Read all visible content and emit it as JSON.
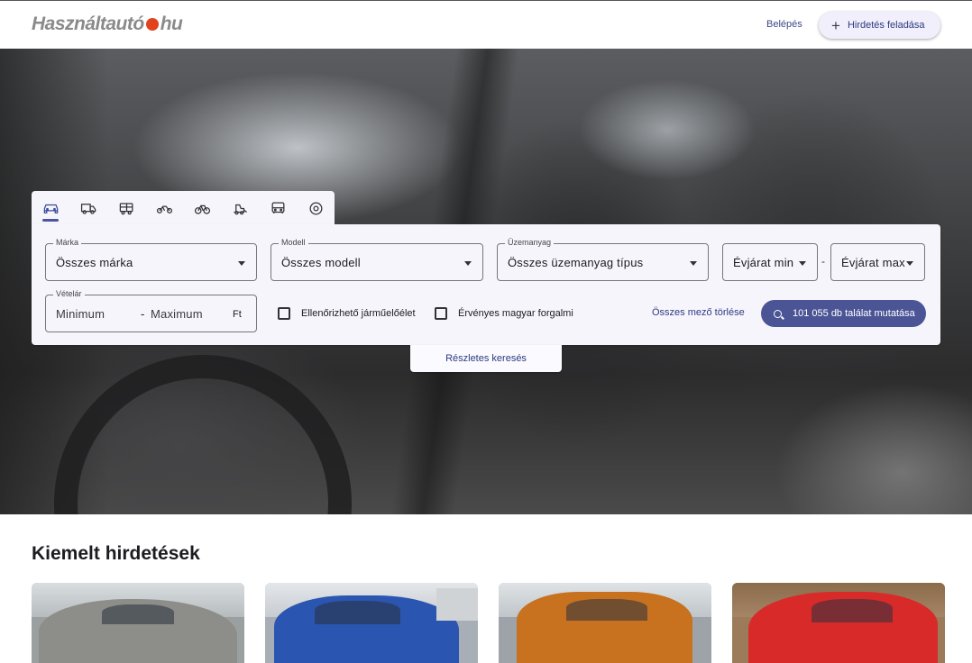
{
  "header": {
    "logo_left": "Használtautó",
    "logo_right": "hu",
    "login_label": "Belépés",
    "post_ad_label": "Hirdetés feladása"
  },
  "vehicle_tabs": [
    {
      "name": "car-icon",
      "active": true
    },
    {
      "name": "truck-icon",
      "active": false
    },
    {
      "name": "camper-icon",
      "active": false
    },
    {
      "name": "motorcycle-icon",
      "active": false
    },
    {
      "name": "bicycle-icon",
      "active": false
    },
    {
      "name": "machinery-icon",
      "active": false
    },
    {
      "name": "bus-icon",
      "active": false
    },
    {
      "name": "parts-icon",
      "active": false
    }
  ],
  "search": {
    "brand": {
      "label": "Márka",
      "value": "Összes márka"
    },
    "model": {
      "label": "Modell",
      "value": "Összes modell"
    },
    "fuel": {
      "label": "Üzemanyag",
      "value": "Összes üzemanyag típus"
    },
    "year_min": {
      "value": "Évjárat min"
    },
    "year_max": {
      "value": "Évjárat max"
    },
    "year_separator": "-",
    "price": {
      "label": "Vételár",
      "min_placeholder": "Minimum",
      "separator": "-",
      "max_placeholder": "Maximum",
      "currency": "Ft"
    },
    "checkbox_verifiable": "Ellenőrizhető járműelőélet",
    "checkbox_registration": "Érvényes magyar forgalmi",
    "clear_all": "Összes mező törlése",
    "results_button": "101 055 db találat mutatása",
    "detailed_search": "Részletes keresés"
  },
  "featured": {
    "title": "Kiemelt hirdetések"
  },
  "colors": {
    "accent": "#4b5596",
    "link": "#2c3a80",
    "logo_dot": "#e0431d",
    "panel_bg": "#f7f5fc"
  }
}
